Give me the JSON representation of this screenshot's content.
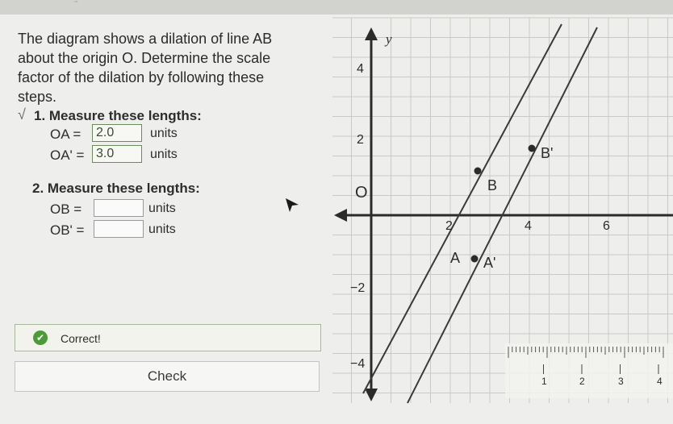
{
  "instructions": {
    "line1": "The diagram shows a dilation of line AB",
    "line2": "about the origin O. Determine the scale",
    "line3": "factor of the dilation by following these",
    "line4": "steps."
  },
  "step1": {
    "check_glyph": "√",
    "title": "1. Measure these lengths:",
    "rows": [
      {
        "label": "OA =",
        "value": "2.0",
        "unit": "units"
      },
      {
        "label": "OA' =",
        "value": "3.0",
        "unit": "units"
      }
    ]
  },
  "step2": {
    "title": "2. Measure these lengths:",
    "rows": [
      {
        "label": "OB =",
        "value": "",
        "unit": "units"
      },
      {
        "label": "OB' =",
        "value": "",
        "unit": "units"
      }
    ]
  },
  "feedback": {
    "icon": "check-circle-icon",
    "text": "Correct!"
  },
  "check_button": {
    "label": "Check"
  },
  "graph": {
    "y_axis_label": "y",
    "origin_label": "O",
    "x_ticks": [
      "2",
      "4",
      "6"
    ],
    "y_ticks": [
      "4",
      "2",
      "−2",
      "−4"
    ],
    "points": [
      {
        "label": "A"
      },
      {
        "label": "A'"
      },
      {
        "label": "B"
      },
      {
        "label": "B'"
      }
    ]
  },
  "ruler": {
    "labels": [
      "1",
      "2",
      "3",
      "4"
    ]
  },
  "colors": {
    "correct": "#4c9a3a",
    "answer_border": "#6d8a5a",
    "grid": "#c9c9c6"
  }
}
